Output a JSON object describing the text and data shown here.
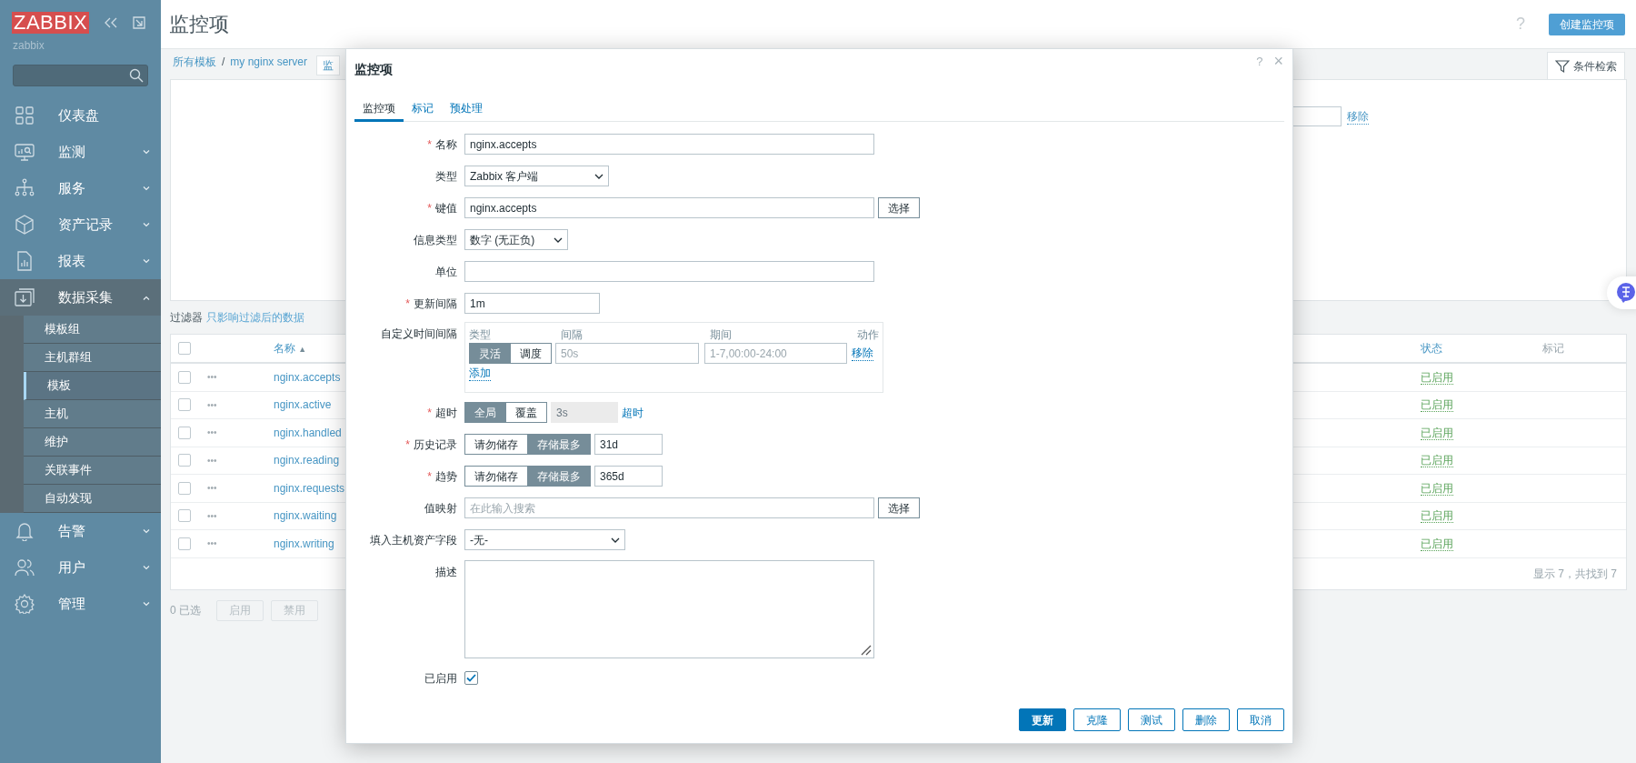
{
  "sidebar": {
    "logo": "ZABBIX",
    "server_name": "zabbix",
    "menu": [
      {
        "label": "仪表盘",
        "kind": "link"
      },
      {
        "label": "监测",
        "kind": "group",
        "expanded": false
      },
      {
        "label": "服务",
        "kind": "group",
        "expanded": false
      },
      {
        "label": "资产记录",
        "kind": "group",
        "expanded": false
      },
      {
        "label": "报表",
        "kind": "group",
        "expanded": false
      },
      {
        "label": "数据采集",
        "kind": "group",
        "expanded": true,
        "children": [
          {
            "label": "模板组",
            "selected": false
          },
          {
            "label": "主机群组",
            "selected": false
          },
          {
            "label": "模板",
            "selected": true
          },
          {
            "label": "主机",
            "selected": false
          },
          {
            "label": "维护",
            "selected": false
          },
          {
            "label": "关联事件",
            "selected": false
          },
          {
            "label": "自动发现",
            "selected": false
          }
        ]
      },
      {
        "label": "告警",
        "kind": "group",
        "expanded": false
      },
      {
        "label": "用户",
        "kind": "group",
        "expanded": false
      },
      {
        "label": "管理",
        "kind": "group",
        "expanded": false
      }
    ]
  },
  "page": {
    "title": "监控项",
    "help": "?",
    "create_button": "创建监控项"
  },
  "breadcrumbs": {
    "items": [
      "所有模板",
      "my nginx server"
    ],
    "separator": "/",
    "tab": "监"
  },
  "filter": {
    "tab": "条件检索",
    "remove_link": "移除",
    "label": "过滤器",
    "note": "只影响过滤后的数据"
  },
  "table": {
    "select_all_checked": false,
    "columns": [
      {
        "label": "名称",
        "sort": "▲"
      },
      {
        "label": "状态"
      },
      {
        "label": "标记"
      }
    ],
    "rows": [
      {
        "checked": false,
        "menu": "•••",
        "name": "nginx.accepts",
        "status": "已启用"
      },
      {
        "checked": false,
        "menu": "•••",
        "name": "nginx.active",
        "status": "已启用"
      },
      {
        "checked": false,
        "menu": "•••",
        "name": "nginx.handled",
        "status": "已启用"
      },
      {
        "checked": false,
        "menu": "•••",
        "name": "nginx.reading",
        "status": "已启用"
      },
      {
        "checked": false,
        "menu": "•••",
        "name": "nginx.requests",
        "status": "已启用"
      },
      {
        "checked": false,
        "menu": "•••",
        "name": "nginx.waiting",
        "status": "已启用"
      },
      {
        "checked": false,
        "menu": "•••",
        "name": "nginx.writing",
        "status": "已启用"
      }
    ],
    "footer": "显示 7，共找到 7"
  },
  "actions": {
    "selected_count": "0 已选",
    "buttons": [
      {
        "label": "启用",
        "disabled": true
      },
      {
        "label": "禁用",
        "disabled": true
      }
    ]
  },
  "dialog": {
    "title": "监控项",
    "help": "?",
    "close": "×",
    "tabs": [
      {
        "label": "监控项",
        "selected": true
      },
      {
        "label": "标记",
        "selected": false
      },
      {
        "label": "预处理",
        "selected": false
      }
    ],
    "fields": [
      {
        "kind": "input",
        "mark": "*",
        "label": "名称",
        "value": "nginx.accepts"
      },
      {
        "kind": "select",
        "label": "类型",
        "value": "Zabbix 客户端"
      },
      {
        "kind": "input_button",
        "mark": "*",
        "label": "键值",
        "value": "nginx.accepts",
        "button": "选择"
      },
      {
        "kind": "select",
        "label": "信息类型",
        "value": "数字 (无正负)"
      },
      {
        "kind": "input",
        "label": "单位"
      },
      {
        "kind": "short_input",
        "mark": "*",
        "label": "更新间隔",
        "value": "1m"
      },
      {
        "kind": "interval_table",
        "label": "自定义时间间隔",
        "columns": [
          "类型",
          "间隔",
          "期间",
          "动作"
        ],
        "rows": [
          {
            "options": [
              {
                "label": "灵活",
                "selected": true
              },
              {
                "label": "调度",
                "selected": false
              }
            ],
            "interval_placeholder": "50s",
            "period_placeholder": "1-7,00:00-24:00",
            "remove": "移除"
          }
        ],
        "add": "添加"
      },
      {
        "kind": "segmented_input",
        "mark": "*",
        "label": "超时",
        "options": [
          {
            "label": "全局",
            "selected": true
          },
          {
            "label": "覆盖",
            "selected": false
          }
        ],
        "value": "3s",
        "disabled": true,
        "link": "超时"
      },
      {
        "kind": "segmented_input",
        "mark": "*",
        "label": "历史记录",
        "options": [
          {
            "label": "请勿储存",
            "selected": false
          },
          {
            "label": "存储最多",
            "selected": true
          }
        ],
        "value": "31d",
        "disabled": false
      },
      {
        "kind": "segmented_input",
        "mark": "*",
        "label": "趋势",
        "options": [
          {
            "label": "请勿储存",
            "selected": false
          },
          {
            "label": "存储最多",
            "selected": true
          }
        ],
        "value": "365d",
        "disabled": false
      },
      {
        "kind": "input_button",
        "label": "值映射",
        "placeholder": "在此输入搜索",
        "button": "选择"
      },
      {
        "kind": "select",
        "label": "填入主机资产字段",
        "value": "-无-"
      },
      {
        "kind": "textarea",
        "label": "描述"
      },
      {
        "kind": "checkbox",
        "label": "已启用",
        "checked": true
      }
    ],
    "buttons": [
      {
        "label": "更新",
        "primary": true
      },
      {
        "label": "克隆",
        "primary": false
      },
      {
        "label": "测试",
        "primary": false
      },
      {
        "label": "删除",
        "primary": false
      },
      {
        "label": "取消",
        "primary": false
      }
    ]
  }
}
